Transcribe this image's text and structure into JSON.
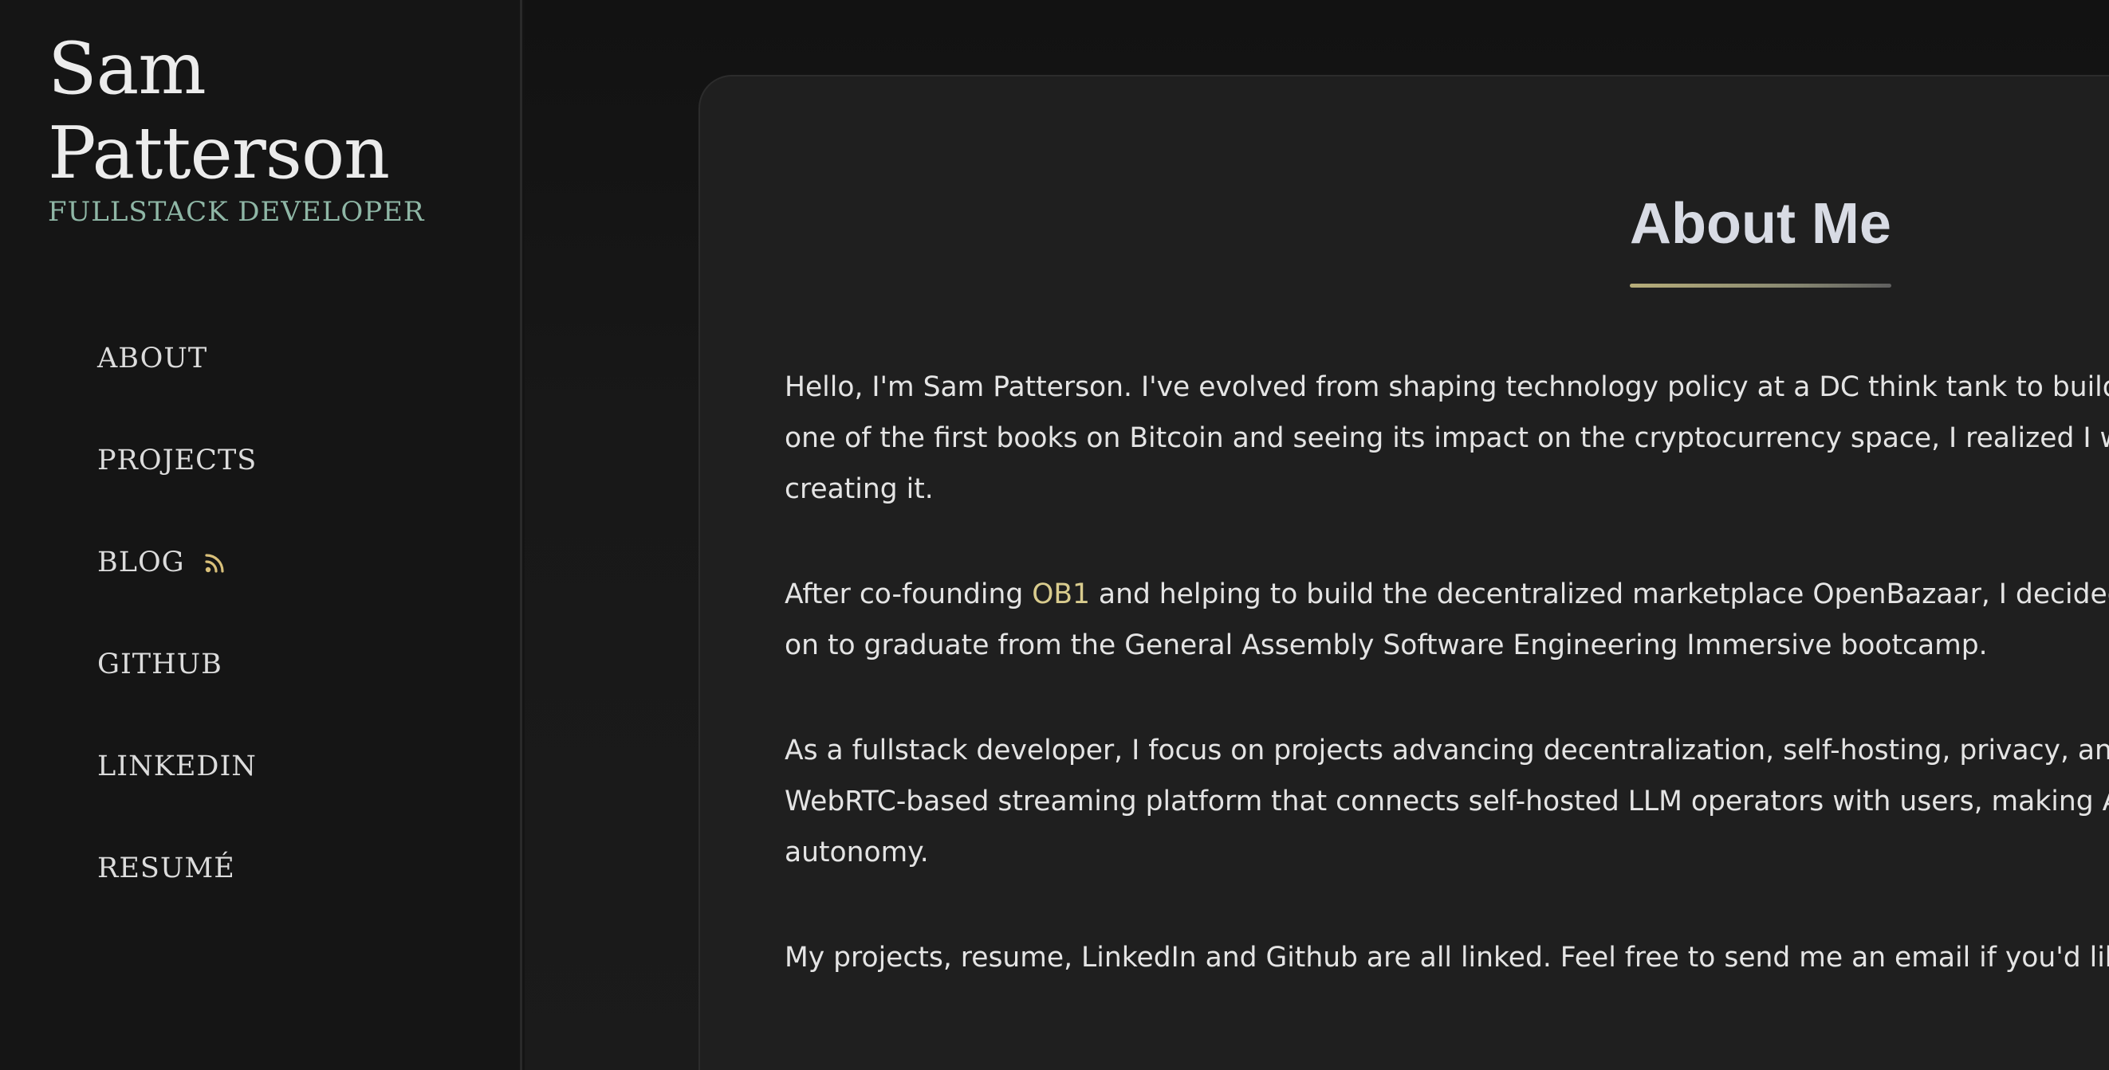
{
  "sidebar": {
    "name_line1": "Sam",
    "name_line2": "Patterson",
    "role": "FULLSTACK DEVELOPER",
    "nav": [
      {
        "label": "ABOUT"
      },
      {
        "label": "PROJECTS"
      },
      {
        "label": "BLOG",
        "icon": "rss-icon"
      },
      {
        "label": "GITHUB"
      },
      {
        "label": "LINKEDIN"
      },
      {
        "label": "RESUMÉ"
      }
    ]
  },
  "main": {
    "title": "About Me",
    "p1": {
      "l1": "Hello, I'm Sam Patterson. I've evolved from shaping technology policy at a DC think tank to building",
      "l2": "one of the first books on Bitcoin and seeing its impact on the cryptocurrency space, I realized I wan",
      "l3": "creating it."
    },
    "p2": {
      "l1_pre": "After co-founding ",
      "l1_link": "OB1",
      "l1_post": " and helping to build the decentralized marketplace OpenBazaar, I decided to",
      "l2": "on to graduate from the General Assembly Software Engineering Immersive bootcamp."
    },
    "p3": {
      "l1": "As a fullstack developer, I focus on projects advancing decentralization, self-hosting, privacy, and l",
      "l2": "WebRTC-based streaming platform that connects self-hosted LLM operators with users, making AI",
      "l3": "autonomy."
    },
    "p4": {
      "l1": "My projects, resume, LinkedIn and Github are all linked. Feel free to send me an email if you'd like to"
    }
  },
  "colors": {
    "accent_role": "#8fb7a6",
    "link": "#d9cc8e",
    "rss": "#d9c07a"
  }
}
